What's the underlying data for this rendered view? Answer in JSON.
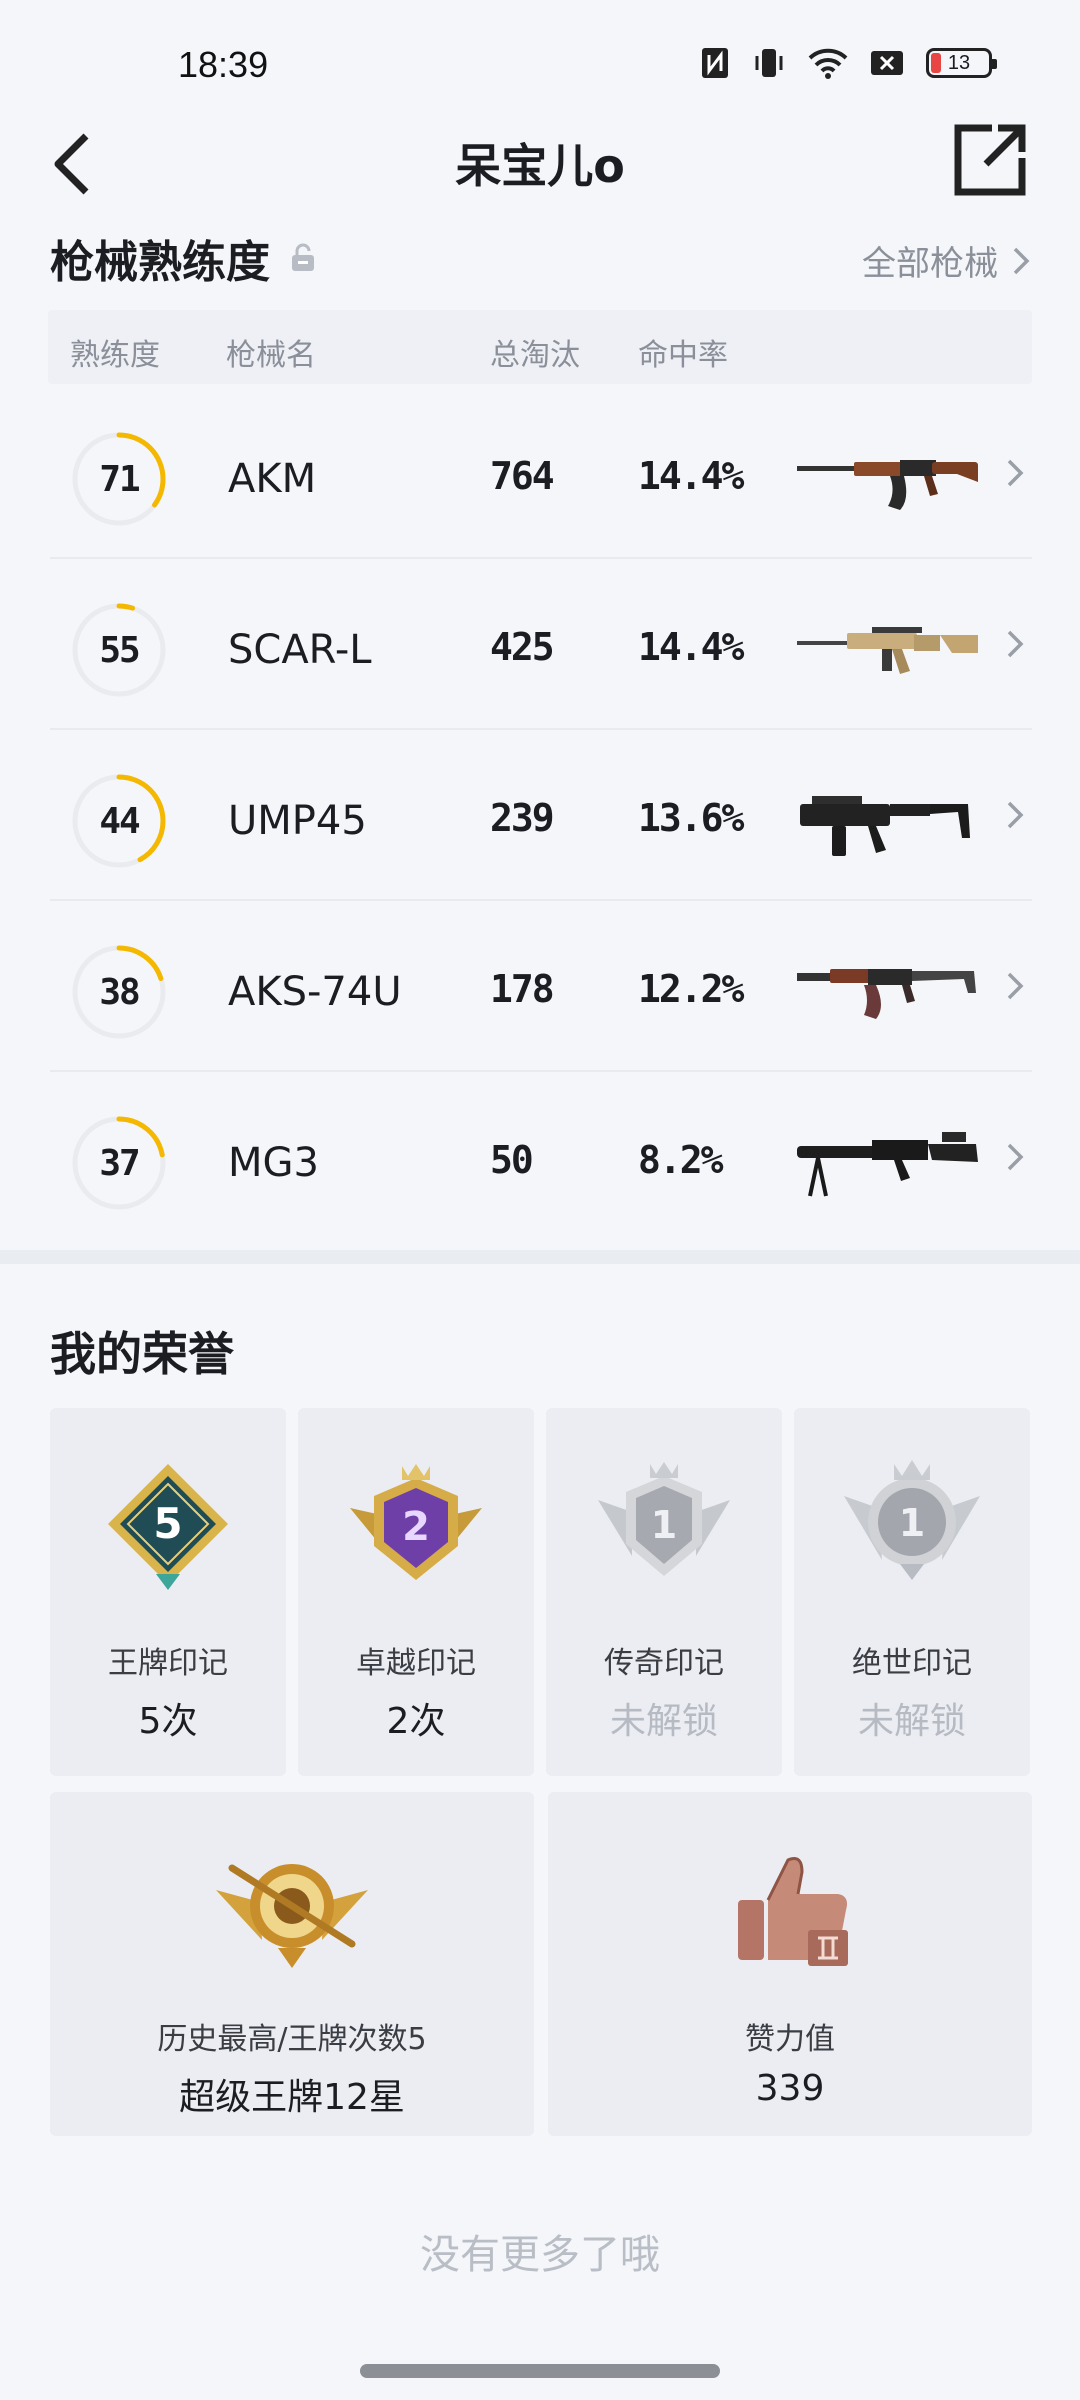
{
  "status_bar": {
    "time": "18:39",
    "battery": "13"
  },
  "header": {
    "title": "呆宝儿o",
    "back_icon": "back-arrow-icon",
    "share_icon": "share-icon"
  },
  "weapon_section": {
    "title": "枪械熟练度",
    "all_link": "全部枪械",
    "columns": {
      "mastery": "熟练度",
      "name": "枪械名",
      "eliminations": "总淘汰",
      "hit_rate": "命中率"
    },
    "accent_color": "#f5b800",
    "weapons": [
      {
        "mastery": "71",
        "progress": 0.35,
        "name": "AKM",
        "eliminations": "764",
        "hit_rate": "14.4%",
        "image": "akm-rifle-icon"
      },
      {
        "mastery": "55",
        "progress": 0.05,
        "name": "SCAR-L",
        "eliminations": "425",
        "hit_rate": "14.4%",
        "image": "scar-l-rifle-icon"
      },
      {
        "mastery": "44",
        "progress": 0.42,
        "name": "UMP45",
        "eliminations": "239",
        "hit_rate": "13.6%",
        "image": "ump45-smg-icon"
      },
      {
        "mastery": "38",
        "progress": 0.2,
        "name": "AKS-74U",
        "eliminations": "178",
        "hit_rate": "12.2%",
        "image": "aks-74u-rifle-icon"
      },
      {
        "mastery": "37",
        "progress": 0.22,
        "name": "MG3",
        "eliminations": "50",
        "hit_rate": "8.2%",
        "image": "mg3-machinegun-icon"
      }
    ]
  },
  "honors": {
    "title": "我的荣誉",
    "badges": [
      {
        "label": "王牌印记",
        "value": "5次",
        "locked": false,
        "emblem_text": "5",
        "icon": "ace-badge-icon"
      },
      {
        "label": "卓越印记",
        "value": "2次",
        "locked": false,
        "emblem_text": "2",
        "icon": "excellence-badge-icon"
      },
      {
        "label": "传奇印记",
        "value": "未解锁",
        "locked": true,
        "emblem_text": "1",
        "icon": "legend-badge-icon"
      },
      {
        "label": "绝世印记",
        "value": "未解锁",
        "locked": true,
        "emblem_text": "1",
        "icon": "peerless-badge-icon"
      }
    ],
    "stats": [
      {
        "label": "历史最高/王牌次数5",
        "value": "超级王牌12星",
        "icon": "super-ace-emblem-icon"
      },
      {
        "label": "赞力值",
        "value": "339",
        "icon": "thumbs-up-icon"
      }
    ]
  },
  "footer": {
    "no_more": "没有更多了哦"
  }
}
